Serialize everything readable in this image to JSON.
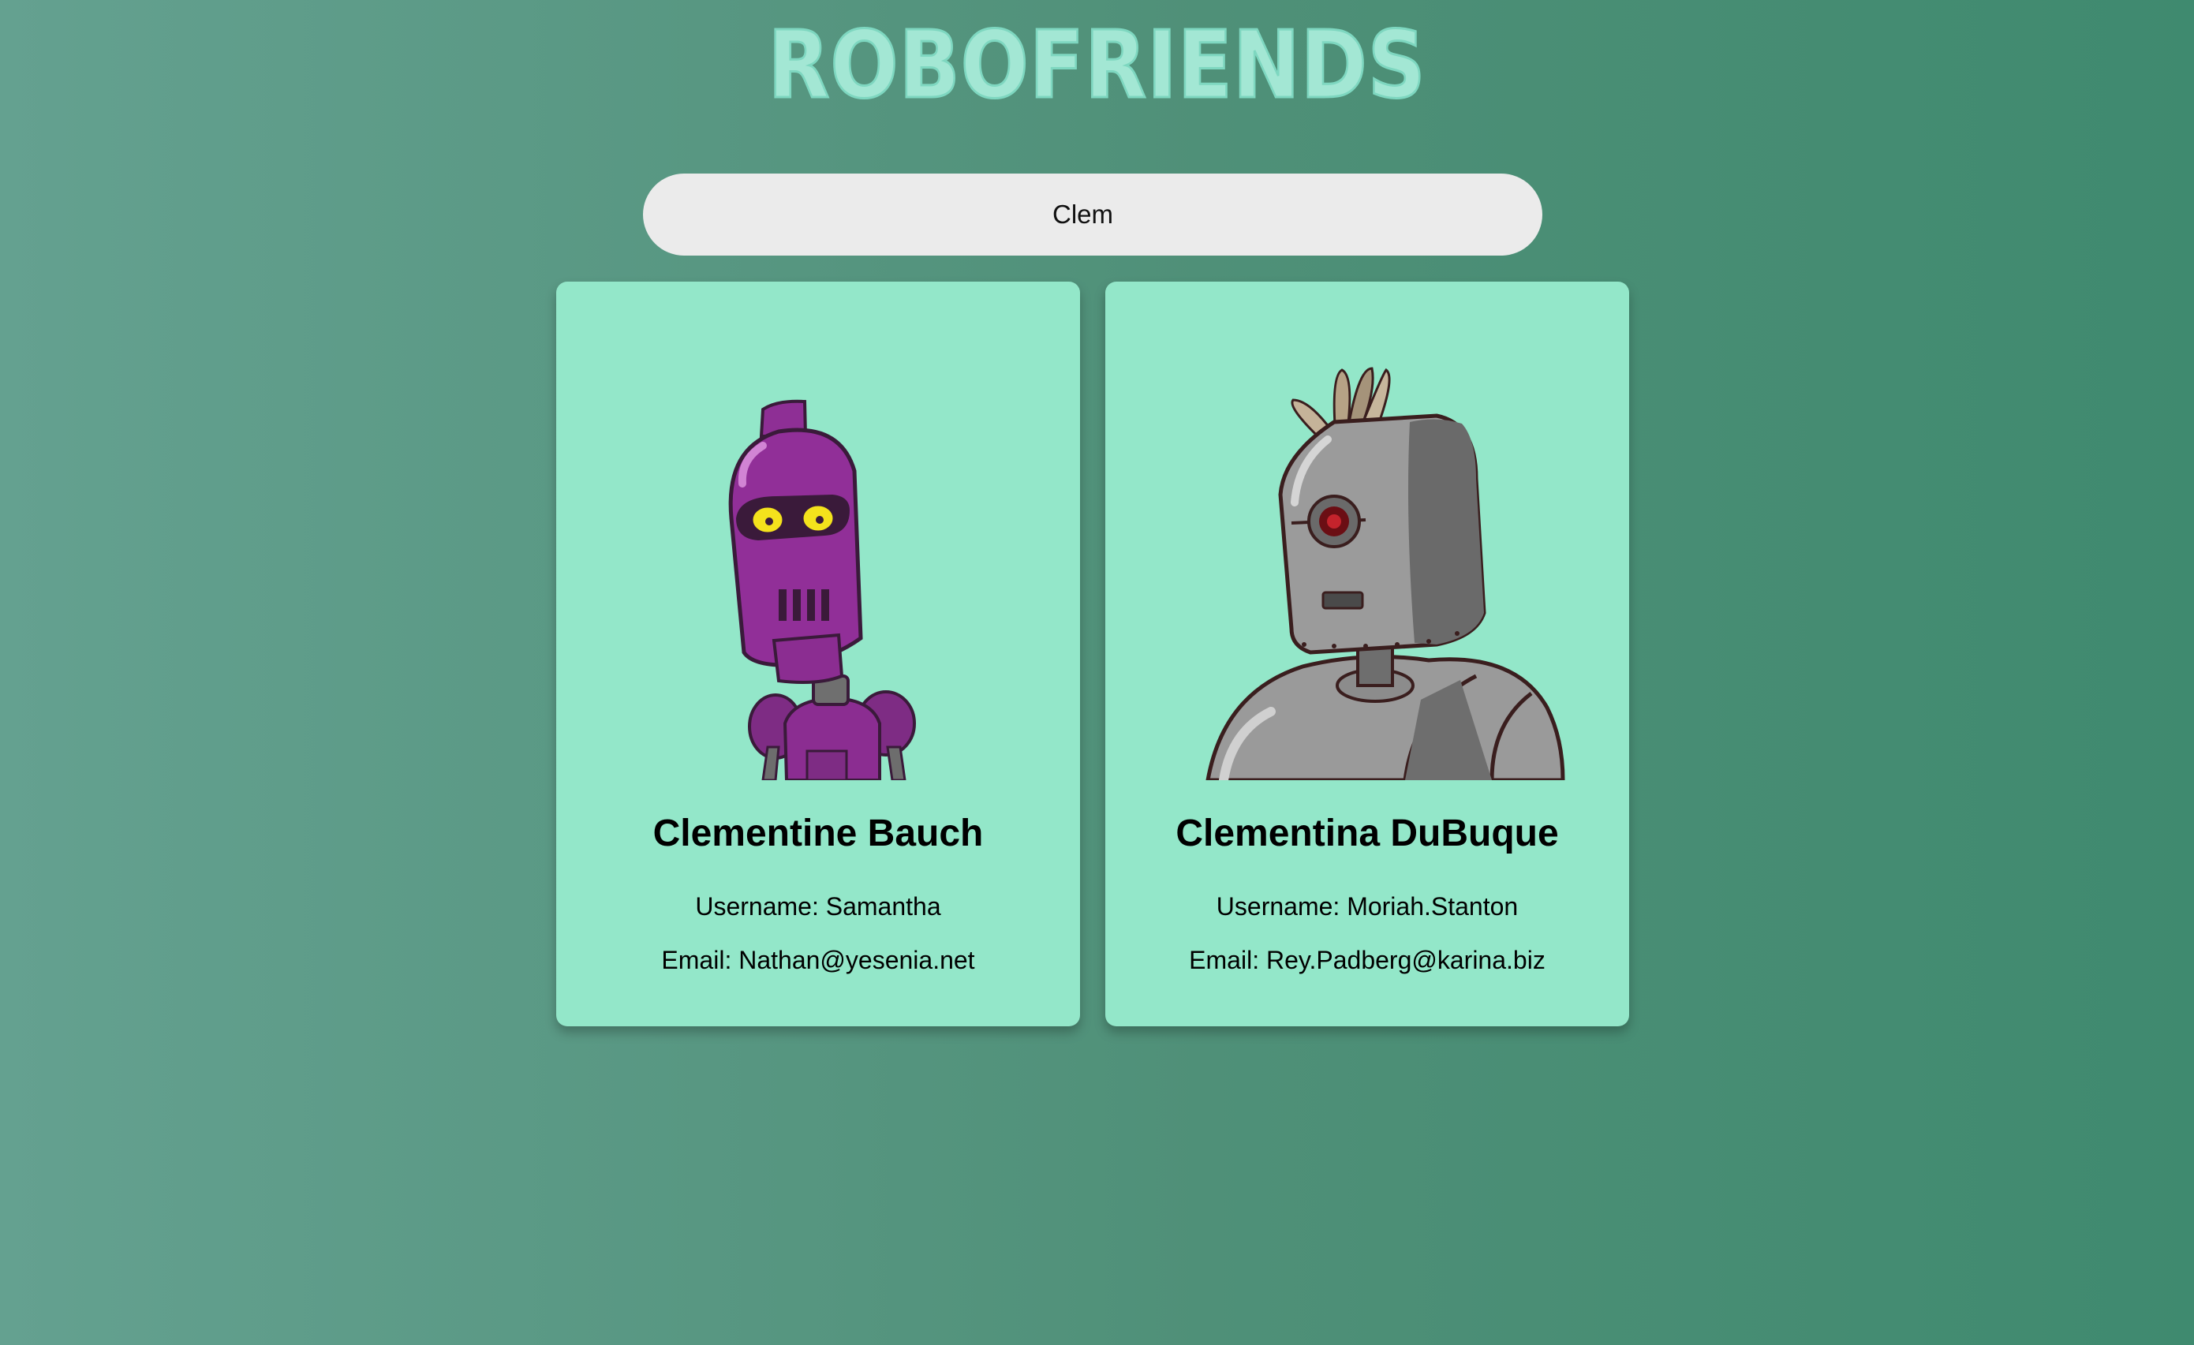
{
  "app": {
    "title": "ROBOFRIENDS"
  },
  "search": {
    "value": "Clem"
  },
  "colors": {
    "background_left": "#64a190",
    "background_right": "#3f8a6f",
    "title": "#a3e7d4",
    "search_bg": "#ebebeb",
    "card_bg": "#93e7c9"
  },
  "robots": [
    {
      "name": "Clementine Bauch",
      "username_label": "Username: Samantha",
      "email_label": "Email: Nathan@yesenia.net",
      "icon": "purple-robot-avatar-icon"
    },
    {
      "name": "Clementina DuBuque",
      "username_label": "Username: Moriah.Stanton",
      "email_label": "Email: Rey.Padberg@karina.biz",
      "icon": "gray-robot-avatar-icon"
    }
  ]
}
